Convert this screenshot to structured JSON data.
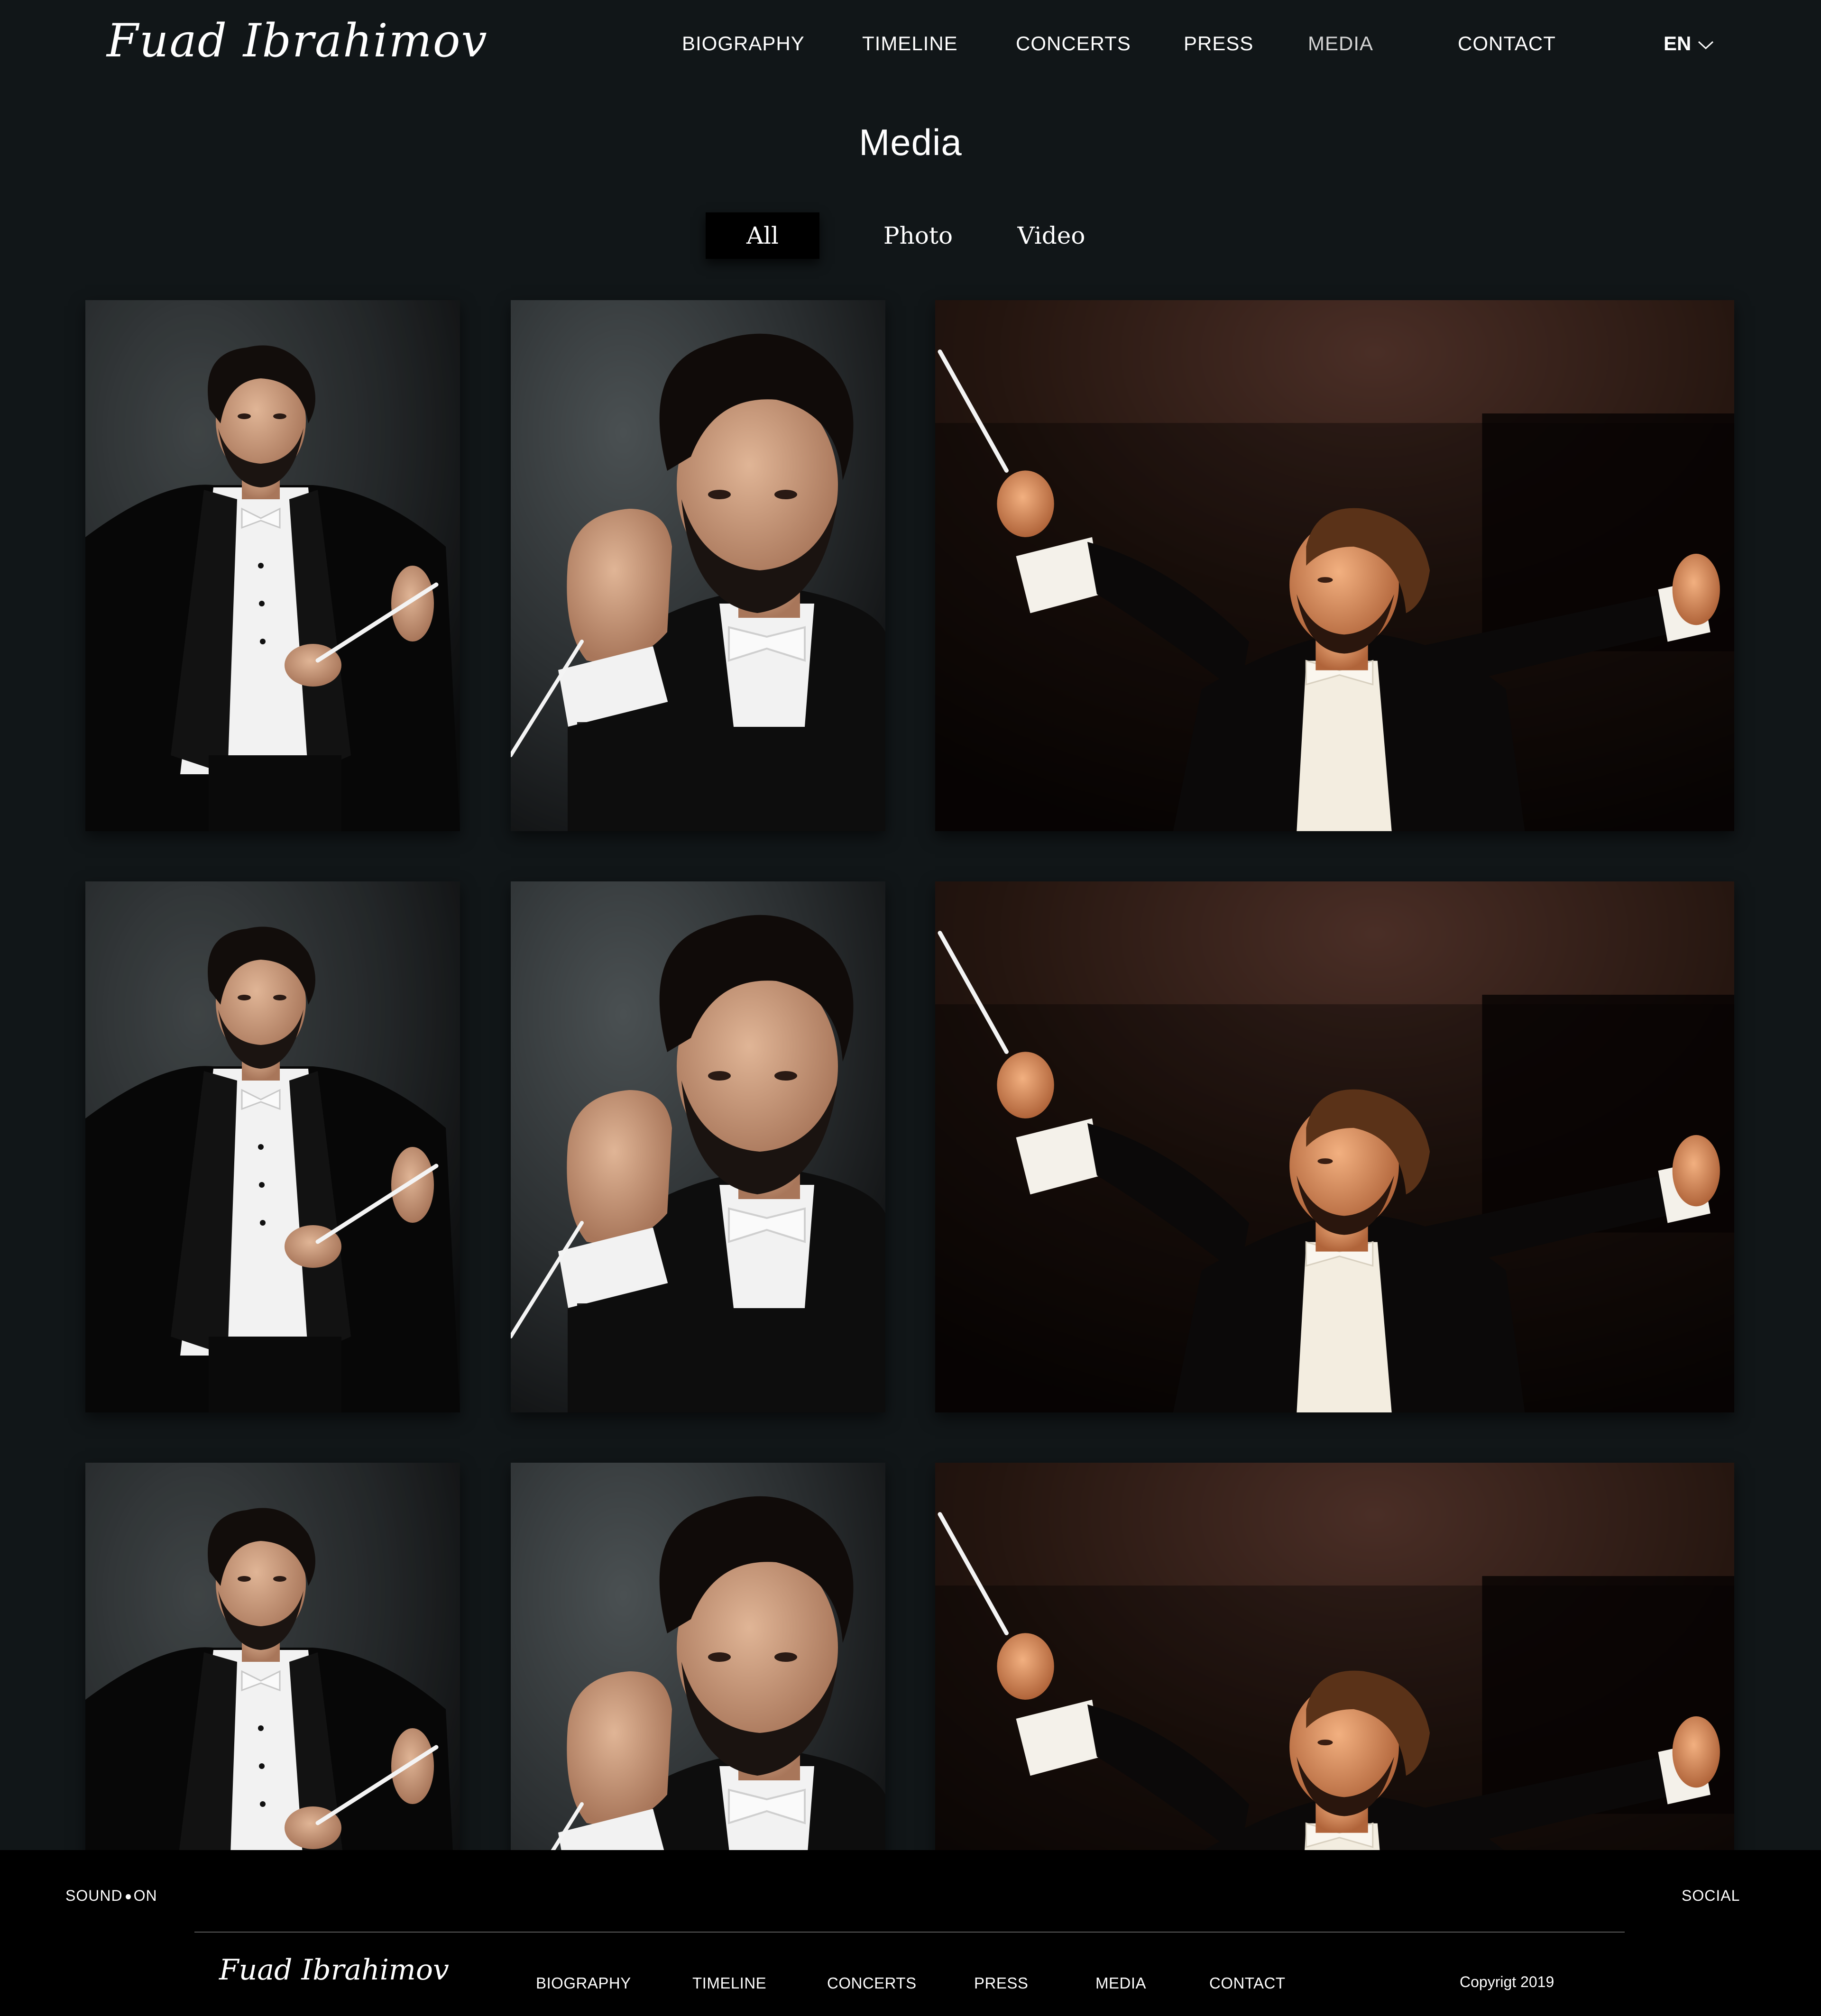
{
  "header": {
    "logo": "Fuad Ibrahimov",
    "nav": [
      {
        "label": "BIOGRAPHY"
      },
      {
        "label": "TIMELINE"
      },
      {
        "label": "CONCERTS"
      },
      {
        "label": "PRESS"
      },
      {
        "label": "MEDIA"
      },
      {
        "label": "CONTACT"
      }
    ],
    "language": "EN",
    "language_icon": "chevron-down-icon"
  },
  "main": {
    "title": "Media",
    "tabs": [
      {
        "label": "All",
        "active": true
      },
      {
        "label": "Photo",
        "active": false
      },
      {
        "label": "Video",
        "active": false
      }
    ],
    "gallery": [
      {
        "image": "conductor-portrait-baton"
      },
      {
        "image": "conductor-portrait-closeup"
      },
      {
        "image": "conductor-performing-on-stage"
      },
      {
        "image": "conductor-portrait-baton"
      },
      {
        "image": "conductor-portrait-closeup"
      },
      {
        "image": "conductor-performing-on-stage"
      },
      {
        "image": "conductor-portrait-baton"
      },
      {
        "image": "conductor-portrait-closeup"
      },
      {
        "image": "conductor-performing-on-stage"
      }
    ]
  },
  "footer": {
    "sound_label": "SOUND",
    "sound_state": "ON",
    "social": "SOCIAL",
    "logo": "Fuad Ibrahimov",
    "nav": [
      {
        "label": "BIOGRAPHY"
      },
      {
        "label": "TIMELINE"
      },
      {
        "label": "CONCERTS"
      },
      {
        "label": "PRESS"
      },
      {
        "label": "MEDIA"
      },
      {
        "label": "CONTACT"
      }
    ],
    "copyright": "Copyrigt 2019"
  }
}
